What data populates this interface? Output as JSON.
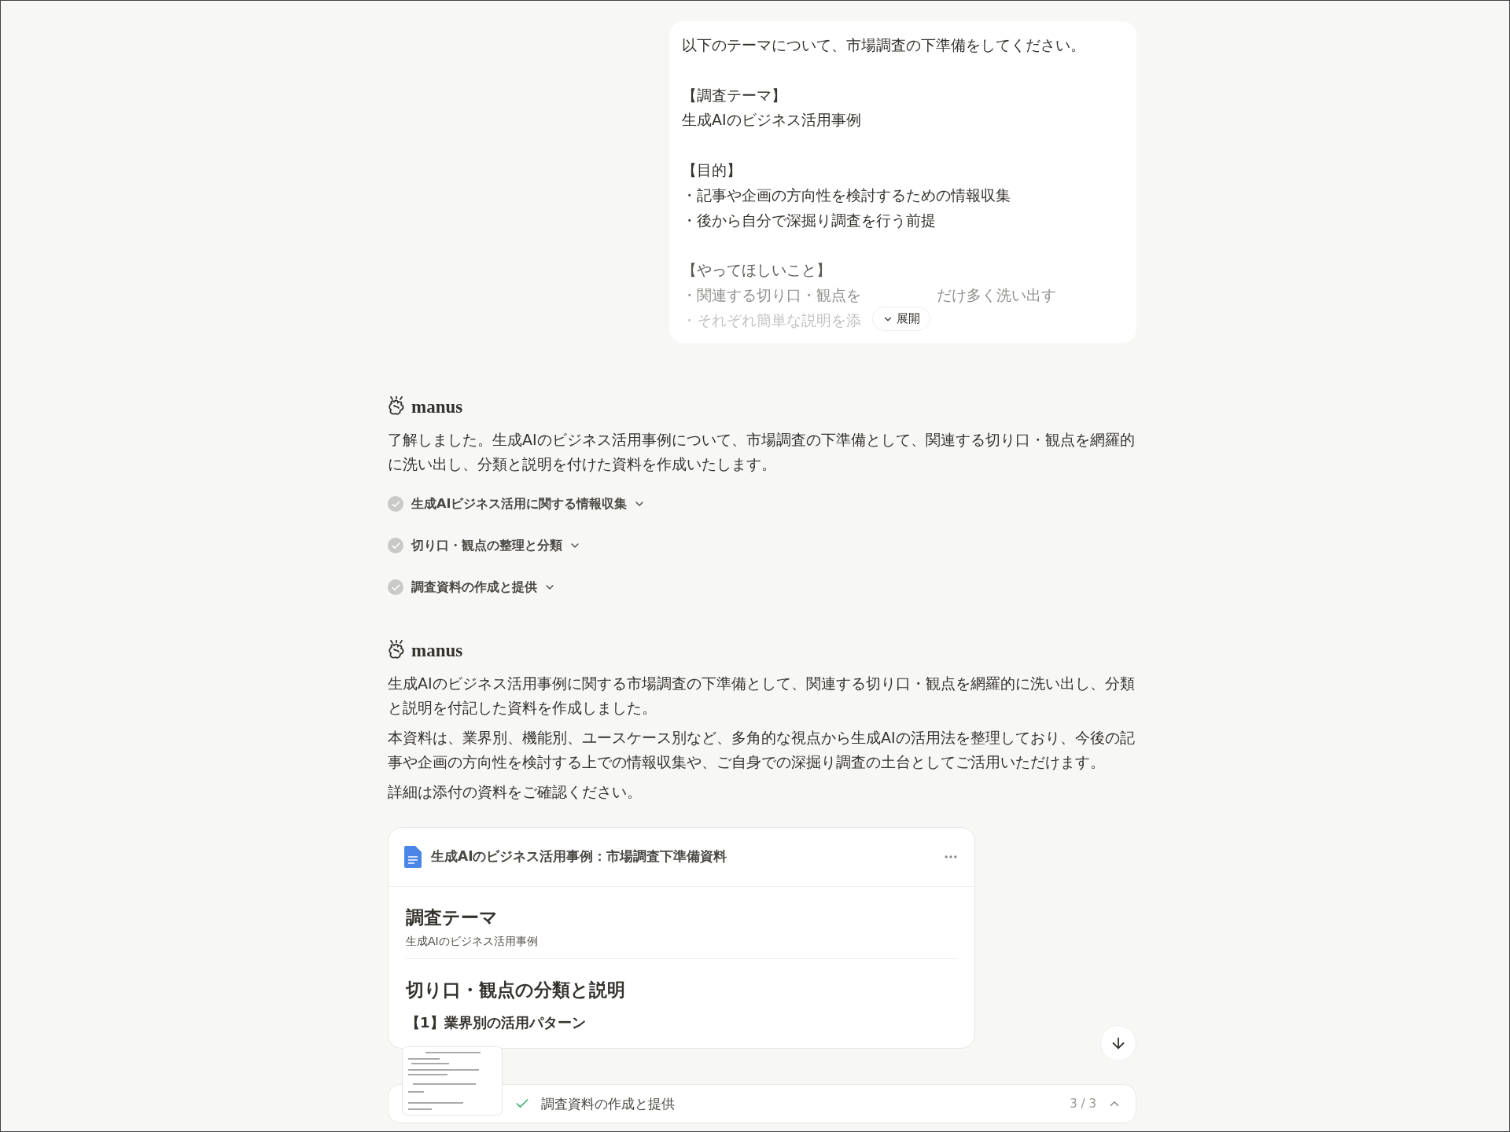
{
  "user_message": {
    "paragraphs": [
      [
        "以下のテーマについて、市場調査の下準備をしてください。"
      ],
      [
        "【調査テーマ】",
        "生成AIのビジネス活用事例"
      ],
      [
        "【目的】",
        "・記事や企画の方向性を検討するための情報収集",
        "・後から自分で深掘り調査を行う前提"
      ],
      [
        "【やってほしいこと】",
        [
          "・関連する切り口・観点を",
          "だけ多く洗い出す"
        ],
        "・それぞれ簡単な説明を添"
      ]
    ],
    "collapsed": true,
    "expand_label": "展開"
  },
  "replies": [
    {
      "sender": "manus",
      "paragraphs": [
        "了解しました。生成AIのビジネス活用事例について、市場調査の下準備として、関連する切り口・観点を網羅的に洗い出し、分類と説明を付けた資料を作成いたします。"
      ],
      "steps": [
        {
          "label": "生成AIビジネス活用に関する情報収集",
          "done": true,
          "expanded": false
        },
        {
          "label": "切り口・観点の整理と分類",
          "done": true,
          "expanded": false
        },
        {
          "label": "調査資料の作成と提供",
          "done": true,
          "expanded": false
        }
      ]
    },
    {
      "sender": "manus",
      "paragraphs": [
        "生成AIのビジネス活用事例に関する市場調査の下準備として、関連する切り口・観点を網羅的に洗い出し、分類と説明を付記した資料を作成しました。",
        "本資料は、業界別、機能別、ユースケース別など、多角的な視点から生成AIの活用法を整理しており、今後の記事や企画の方向性を検討する上での情報収集や、ご自身での深掘り調査の土台としてご活用いただけます。",
        "詳細は添付の資料をご確認ください。"
      ],
      "document": {
        "title": "生成AIのビジネス活用事例：市場調査下準備資料",
        "blocks": [
          {
            "kind": "h1",
            "text": "調査テーマ"
          },
          {
            "kind": "p",
            "text": "生成AIのビジネス活用事例"
          },
          {
            "kind": "rule"
          },
          {
            "kind": "h1",
            "text": "切り口・観点の分類と説明"
          },
          {
            "kind": "h2",
            "text": "【1】業界別の活用パターン"
          }
        ]
      }
    }
  ],
  "status_bar": {
    "done": true,
    "label": "調査資料の作成と提供",
    "progress": "3 / 3"
  }
}
